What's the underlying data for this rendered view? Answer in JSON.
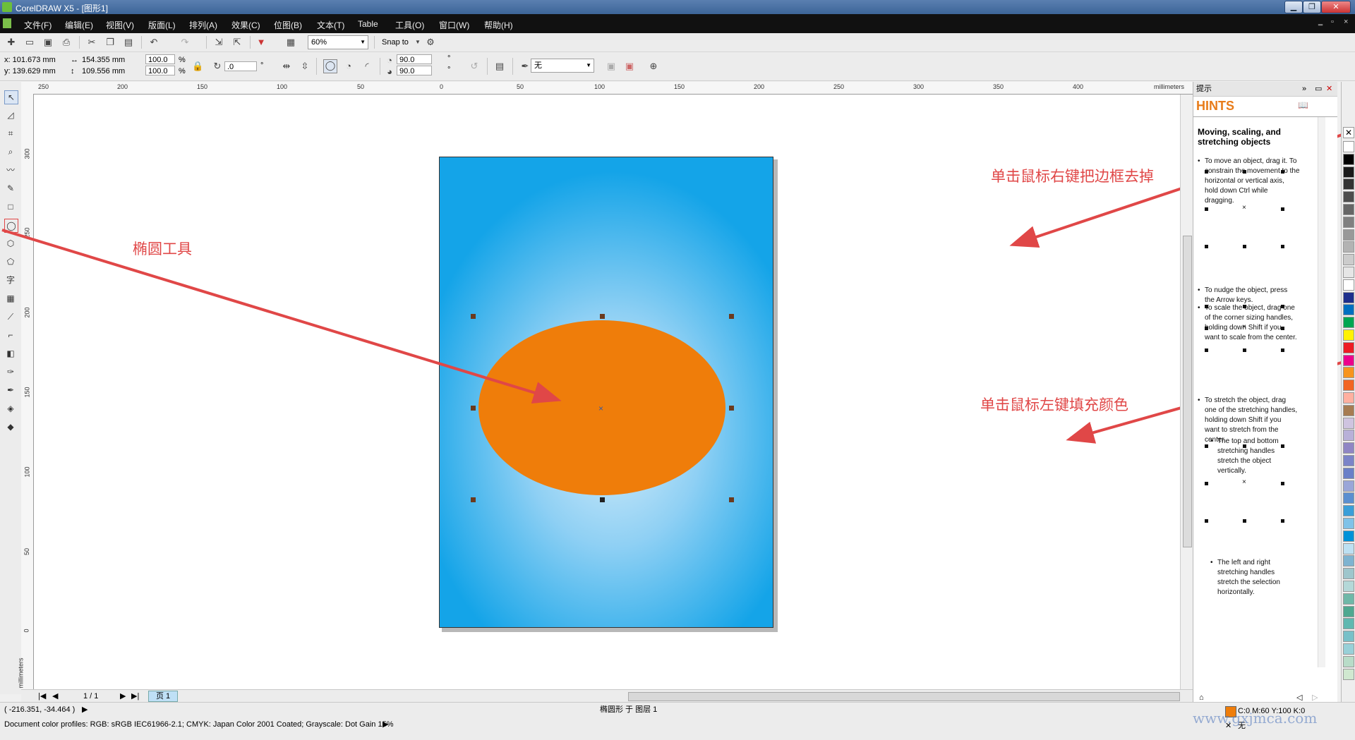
{
  "window": {
    "title": "CorelDRAW X5 - [图形1]",
    "controls": [
      "▁",
      "❐",
      "✕"
    ]
  },
  "menu": [
    "文件(F)",
    "编辑(E)",
    "视图(V)",
    "版面(L)",
    "排列(A)",
    "效果(C)",
    "位图(B)",
    "文本(T)",
    "Table",
    "工具(O)",
    "窗口(W)",
    "帮助(H)"
  ],
  "toolbar": {
    "zoom": "60%",
    "snap": "Snap to"
  },
  "propbar": {
    "x": "x:  101.673 mm",
    "y": "y:  139.629 mm",
    "w": "154.355 mm",
    "h": "109.556 mm",
    "sx": "100.0",
    "sy": "100.0",
    "pct": "%",
    "angle": ".0",
    "deg": "°",
    "a1": "90.0",
    "a2": "90.0",
    "outline": "无"
  },
  "rulers": {
    "h_ticks": [
      "250",
      "200",
      "150",
      "100",
      "50",
      "0",
      "50",
      "100",
      "150",
      "200",
      "250",
      "300",
      "350",
      "400"
    ],
    "h_unit": "millimeters",
    "v_ticks": [
      "300",
      "250",
      "200",
      "150",
      "100",
      "50",
      "0"
    ],
    "v_unit": "millimeters"
  },
  "annotations": {
    "ellipse_tool": "椭圆工具",
    "right_click": "单击鼠标右键把边框去掉",
    "left_click": "单击鼠标左键填充颜色"
  },
  "docker": {
    "title": "提示",
    "hints_label": "HINTS",
    "heading": "Moving, scaling, and stretching objects",
    "p1": [
      "To move an object, drag it. To",
      "constrain the movement to the",
      "horizontal or vertical axis,",
      "hold down Ctrl while",
      "dragging."
    ],
    "p2": [
      "To nudge the object, press",
      "the Arrow keys."
    ],
    "p3": [
      "To scale the object, drag one",
      "of the corner sizing handles,",
      "holding down Shift if you",
      "want to scale from the center."
    ],
    "p4": [
      "To stretch the object, drag",
      "one of the stretching handles,",
      "holding down Shift if you",
      "want to stretch from the",
      "center."
    ],
    "p5": [
      "The top and bottom",
      "stretching handles",
      "stretch the object",
      "vertically."
    ],
    "p6": [
      "The left and right",
      "stretching handles",
      "stretch the selection",
      "horizontally."
    ]
  },
  "pagebar": {
    "count": "1 / 1",
    "tab": "页 1"
  },
  "status": {
    "coords": "( -216.351, -34.464 )",
    "object": "椭圆形 于 图层 1",
    "profiles": "Document color profiles: RGB: sRGB IEC61966-2.1; CMYK: Japan Color 2001 Coated; Grayscale: Dot Gain 15%",
    "fill": "C:0 M:60 Y:100 K:0",
    "outline": "无"
  },
  "colors": {
    "ellipse_fill": "#ef7d0a",
    "page_edge": "#14a4e8",
    "page_center": "#d8eefa",
    "annotation": "#e04747",
    "hints_orange": "#e87c1a"
  },
  "watermark": "www.gxjmca.com",
  "palette": [
    "#ffffff",
    "#000000",
    "#1a1a1a",
    "#333333",
    "#4d4d4d",
    "#666666",
    "#808080",
    "#999999",
    "#b3b3b3",
    "#cccccc",
    "#e6e6e6",
    "#ffffff",
    "#1e2f8c",
    "#0070c0",
    "#00a651",
    "#fff200",
    "#ed1c24",
    "#ec008c",
    "#f7941d",
    "#f26522",
    "#ffb0a0",
    "#a67c52",
    "#cfc4e0",
    "#b8b0d8",
    "#8f86c4",
    "#7b84c8",
    "#6a80c8",
    "#9aa6d8",
    "#5b8fd0",
    "#3a9ed8",
    "#7fc2e8",
    "#0092d8",
    "#bde0f2",
    "#7eb3d0",
    "#9ec6cc",
    "#b4d8d8",
    "#6fb8a8",
    "#4fa890",
    "#5fb8b0",
    "#78c0c8",
    "#98d0d8",
    "#b8dcc8",
    "#d0e8d0"
  ]
}
